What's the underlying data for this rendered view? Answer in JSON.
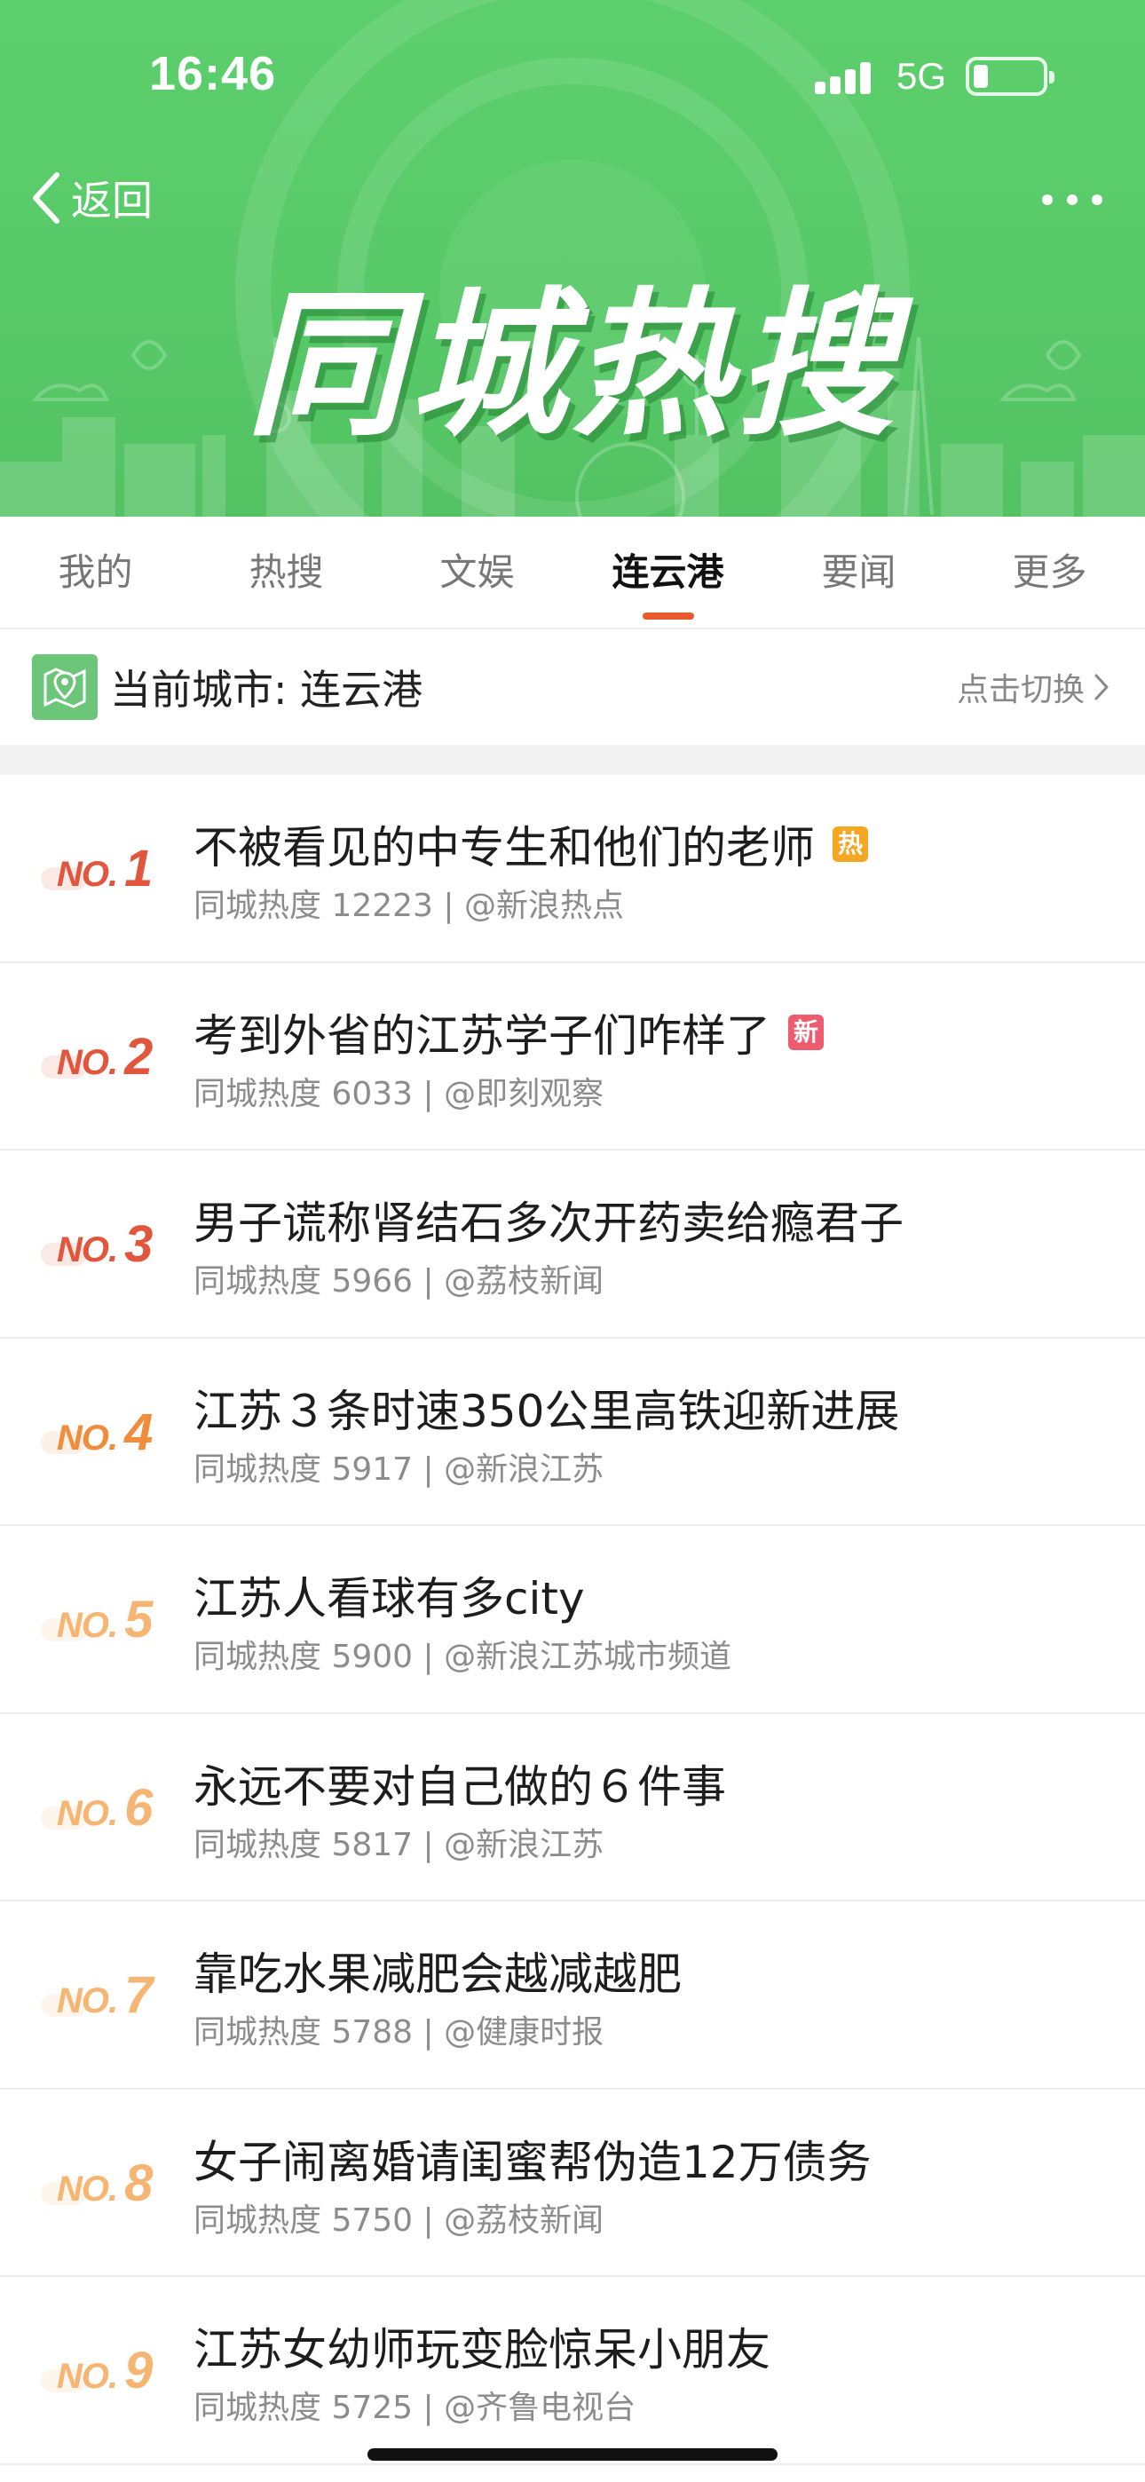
{
  "status_bar": {
    "time": "16:46",
    "network": "5G"
  },
  "header": {
    "back_label": "返回",
    "banner_title": "同城热搜"
  },
  "tabs": [
    {
      "label": "我的",
      "active": false
    },
    {
      "label": "热搜",
      "active": false
    },
    {
      "label": "文娱",
      "active": false
    },
    {
      "label": "连云港",
      "active": true
    },
    {
      "label": "要闻",
      "active": false
    },
    {
      "label": "更多",
      "active": false
    }
  ],
  "city_bar": {
    "label": "当前城市: 连云港",
    "switch_label": "点击切换"
  },
  "colors": {
    "header_green": "#58c968",
    "active_tab_underline": "#ea5a2f",
    "rank_red": "#e2563d",
    "rank_orange": "#f08c3a",
    "rank_light_orange": "#f6b572",
    "badge_hot": "#f5a623",
    "badge_new": "#ef5b6f"
  },
  "list": [
    {
      "rank_prefix": "NO.",
      "rank": "1",
      "title": "不被看见的中专生和他们的老师",
      "badge": "热",
      "badge_type": "hot",
      "meta": "同城热度 12223 | @新浪热点"
    },
    {
      "rank_prefix": "NO.",
      "rank": "2",
      "title": "考到外省的江苏学子们咋样了",
      "badge": "新",
      "badge_type": "new",
      "meta": "同城热度 6033 | @即刻观察"
    },
    {
      "rank_prefix": "NO.",
      "rank": "3",
      "title": "男子谎称肾结石多次开药卖给瘾君子",
      "badge": "",
      "badge_type": "",
      "meta": "同城热度 5966 | @荔枝新闻"
    },
    {
      "rank_prefix": "NO.",
      "rank": "4",
      "title": "江苏３条时速350公里高铁迎新进展",
      "badge": "",
      "badge_type": "",
      "meta": "同城热度 5917 | @新浪江苏"
    },
    {
      "rank_prefix": "NO.",
      "rank": "5",
      "title": "江苏人看球有多city",
      "badge": "",
      "badge_type": "",
      "meta": "同城热度 5900 | @新浪江苏城市频道"
    },
    {
      "rank_prefix": "NO.",
      "rank": "6",
      "title": "永远不要对自己做的６件事",
      "badge": "",
      "badge_type": "",
      "meta": "同城热度 5817 | @新浪江苏"
    },
    {
      "rank_prefix": "NO.",
      "rank": "7",
      "title": "靠吃水果减肥会越减越肥",
      "badge": "",
      "badge_type": "",
      "meta": "同城热度 5788 | @健康时报"
    },
    {
      "rank_prefix": "NO.",
      "rank": "8",
      "title": "女子闹离婚请闺蜜帮伪造12万债务",
      "badge": "",
      "badge_type": "",
      "meta": "同城热度 5750 | @荔枝新闻"
    },
    {
      "rank_prefix": "NO.",
      "rank": "9",
      "title": "江苏女幼师玩变脸惊呆小朋友",
      "badge": "",
      "badge_type": "",
      "meta": "同城热度 5725 | @齐鲁电视台"
    }
  ]
}
